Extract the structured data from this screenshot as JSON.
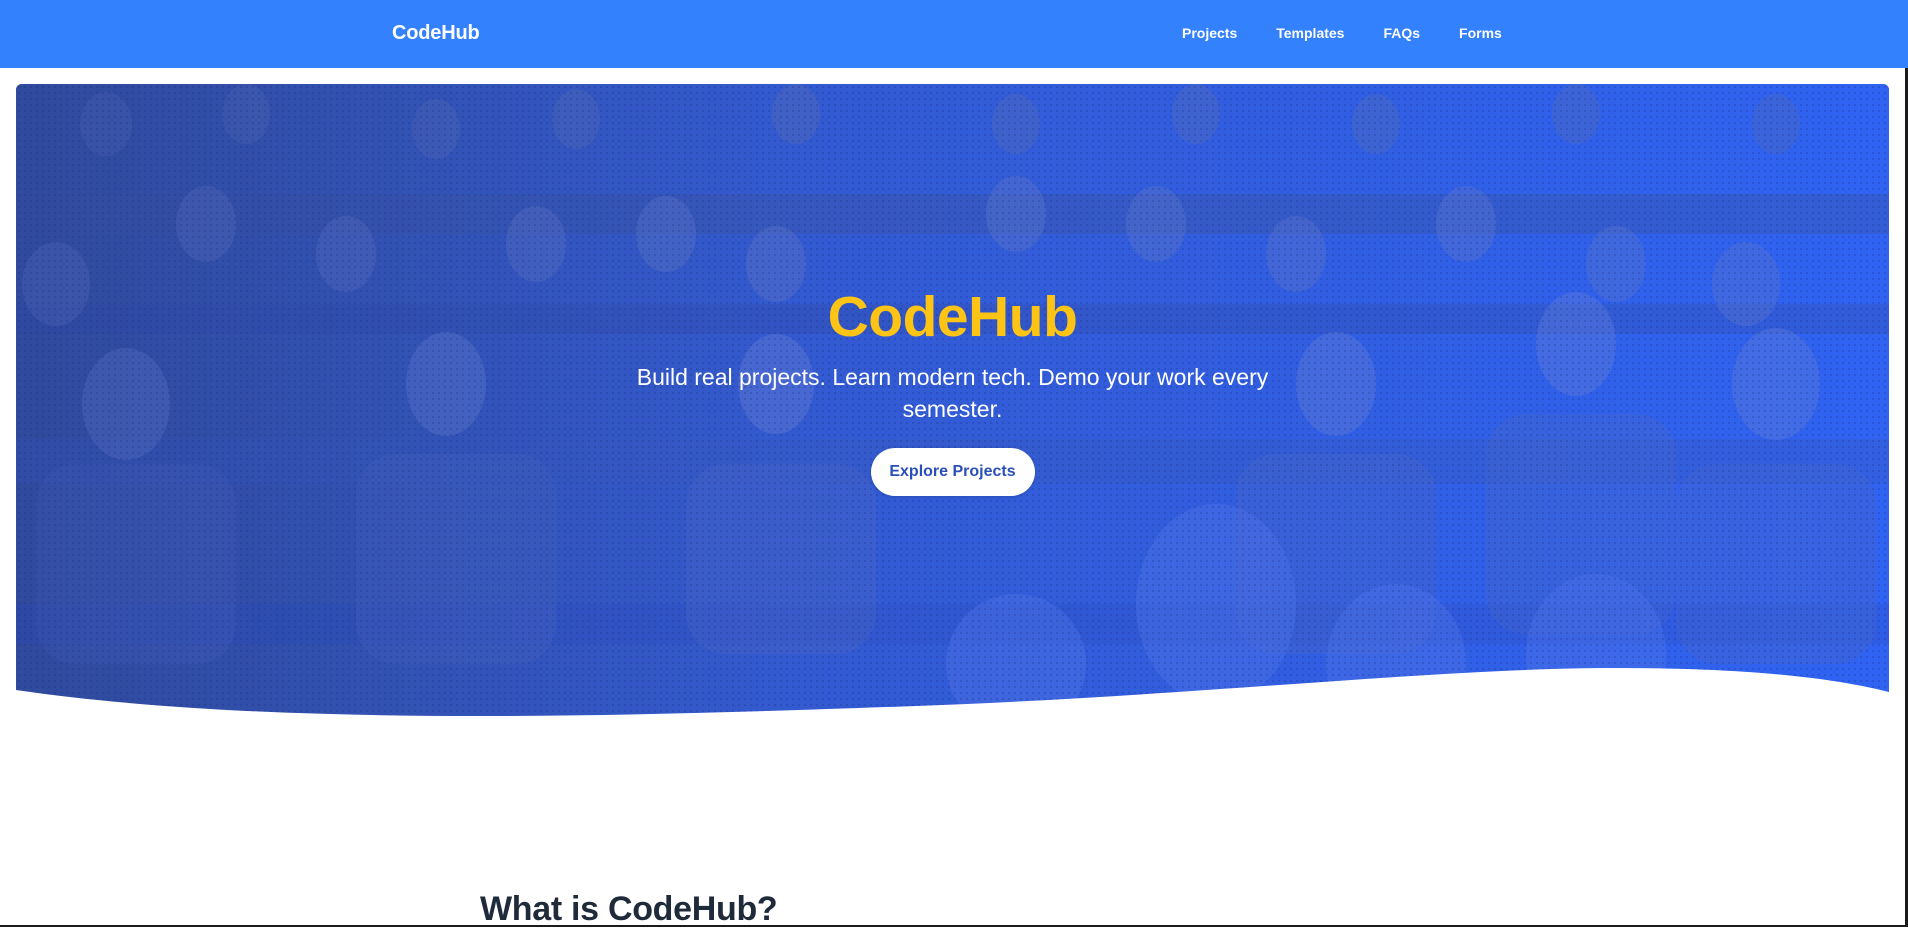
{
  "navbar": {
    "brand": "CodeHub",
    "links": [
      "Projects",
      "Templates",
      "FAQs",
      "Forms"
    ],
    "background": "#3381fd"
  },
  "hero": {
    "title": "CodeHub",
    "subtitle": "Build real projects. Learn modern tech. Demo your work every semester.",
    "button_label": "Explore Projects",
    "title_color": "#fdc415",
    "overlay_color": "#2d5ee6"
  },
  "section": {
    "heading": "What is CodeHub?"
  }
}
